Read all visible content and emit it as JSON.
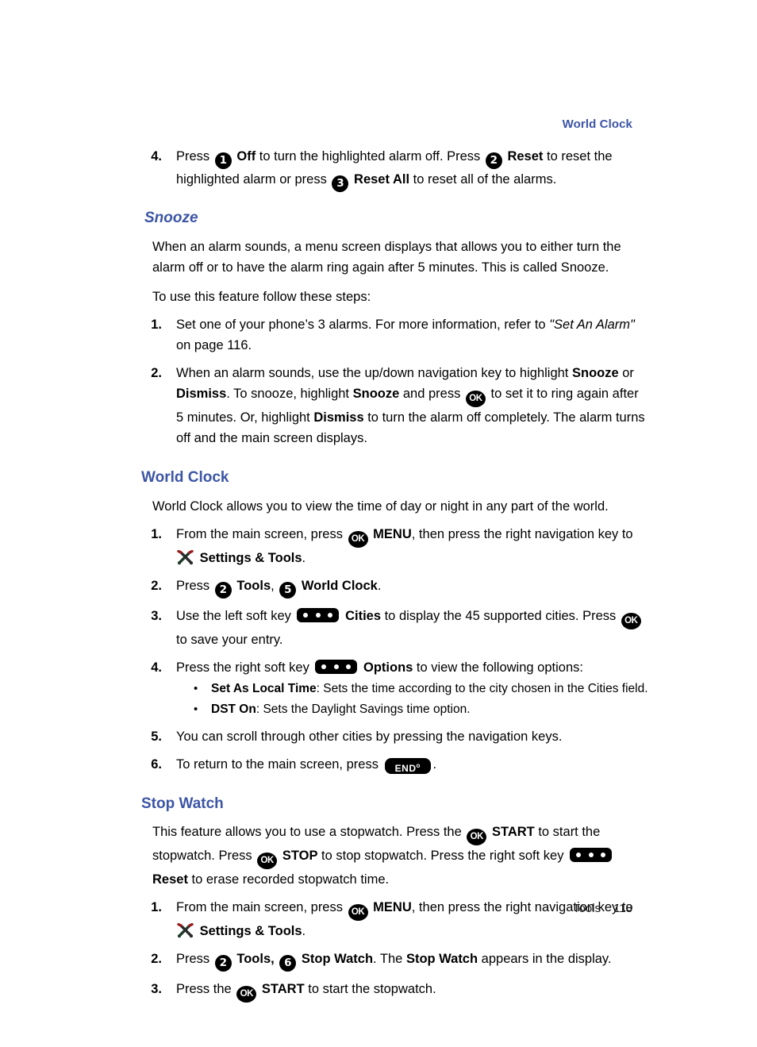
{
  "header": {
    "running_head": "World Clock"
  },
  "footer": {
    "section": "Tools",
    "page_number": "118"
  },
  "colors": {
    "heading_blue": "#3c55a5",
    "key_black": "#000000",
    "body_text": "#000000"
  },
  "icons": {
    "key_1": "1",
    "key_2": "2",
    "key_3": "3",
    "key_5": "5",
    "key_6": "6",
    "ok": "OK",
    "end": "END",
    "end_sup": "o",
    "soft_key": "soft-key-icon",
    "tools": "settings-and-tools-icon"
  },
  "top_step": {
    "number": "4.",
    "parts": {
      "p1": "Press ",
      "b1": "Off",
      "p2": " to turn the highlighted alarm off. Press ",
      "b2": "Reset",
      "p3": " to reset the highlighted alarm or press ",
      "b3": "Reset All",
      "p4": " to reset all of the alarms."
    }
  },
  "snooze": {
    "heading": "Snooze",
    "intro": "When an alarm sounds, a menu screen displays that allows you to either turn the alarm off or to have the alarm ring again after 5 minutes. This is called Snooze.",
    "lead_in": "To use this feature follow these steps:",
    "steps": [
      {
        "number": "1.",
        "p1": "Set one of your phone’s 3 alarms. For more information, refer to ",
        "i1": "\"Set An Alarm\"",
        "p2": " on page 116."
      },
      {
        "number": "2.",
        "p1": "When an alarm sounds, use the up/down navigation key to highlight ",
        "b1": "Snooze",
        "p2": " or ",
        "b2": "Dismiss",
        "p3": ". To snooze, highlight ",
        "b3": "Snooze",
        "p4": " and press ",
        "p5": " to set it to ring again after 5 minutes. Or, highlight ",
        "b4": "Dismiss",
        "p6": " to turn the alarm off completely. The alarm turns off and the main screen displays."
      }
    ]
  },
  "world_clock": {
    "heading": "World Clock",
    "intro": "World Clock allows you to view the time of day or night in any part of the world.",
    "steps": [
      {
        "number": "1.",
        "p1": "From the main screen, press ",
        "b1": "MENU",
        "p2": ", then press the right navigation key to ",
        "b2": "Settings & Tools",
        "p3": "."
      },
      {
        "number": "2.",
        "p1": "Press ",
        "b1": "Tools",
        "p2": ", ",
        "b2": "World Clock",
        "p3": "."
      },
      {
        "number": "3.",
        "p1": "Use the left soft key ",
        "b1": "Cities",
        "p2": " to display the 45 supported cities. Press ",
        "p3": " to save your entry."
      },
      {
        "number": "4.",
        "p1": "Press the right soft key ",
        "b1": "Options",
        "p2": " to view the following options:"
      },
      {
        "number": "5.",
        "p1": "You can scroll through other cities by pressing the navigation keys."
      },
      {
        "number": "6.",
        "p1": "To return to the main screen, press ",
        "p2": "."
      }
    ],
    "options": [
      {
        "label": "Set As Local Time",
        "desc": ": Sets the time according to the city chosen in the Cities field."
      },
      {
        "label": "DST On",
        "desc": ": Sets the Daylight Savings time option."
      }
    ],
    "bullet_glyph": "•"
  },
  "stop_watch": {
    "heading": "Stop Watch",
    "intro": {
      "p1": "This feature allows you to use a stopwatch. Press the ",
      "b1": "START",
      "p2": " to start the stopwatch. Press ",
      "b2": "STOP",
      "p3": " to stop stopwatch. Press the right soft key ",
      "b3": "Reset",
      "p4": " to erase recorded stopwatch time."
    },
    "steps": [
      {
        "number": "1.",
        "p1": "From the main screen, press ",
        "b1": "MENU",
        "p2": ", then press the right navigation key to ",
        "b2": "Settings & Tools",
        "p3": "."
      },
      {
        "number": "2.",
        "p1": "Press ",
        "b1": "Tools,",
        "p2": " ",
        "b2": "Stop Watch",
        "p3": ". The ",
        "b3": "Stop Watch",
        "p4": " appears in the display."
      },
      {
        "number": "3.",
        "p1": "Press the ",
        "b1": "START",
        "p2": " to start the stopwatch."
      }
    ]
  }
}
